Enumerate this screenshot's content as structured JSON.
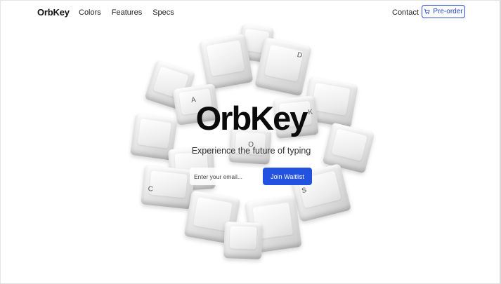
{
  "nav": {
    "logo": "OrbKey",
    "links": [
      "Colors",
      "Features",
      "Specs"
    ],
    "contact": "Contact",
    "preorder": "Pre-order"
  },
  "hero": {
    "title": "OrbKey",
    "subtitle": "Experience the future of typing",
    "email_placeholder": "Enter your email...",
    "cta": "Join Waitlist"
  },
  "keys": {
    "glyphs": [
      "D",
      "A",
      "K",
      "O",
      "S",
      "C"
    ]
  },
  "colors": {
    "accent": "#2452e0",
    "text": "#0b0b0b"
  }
}
